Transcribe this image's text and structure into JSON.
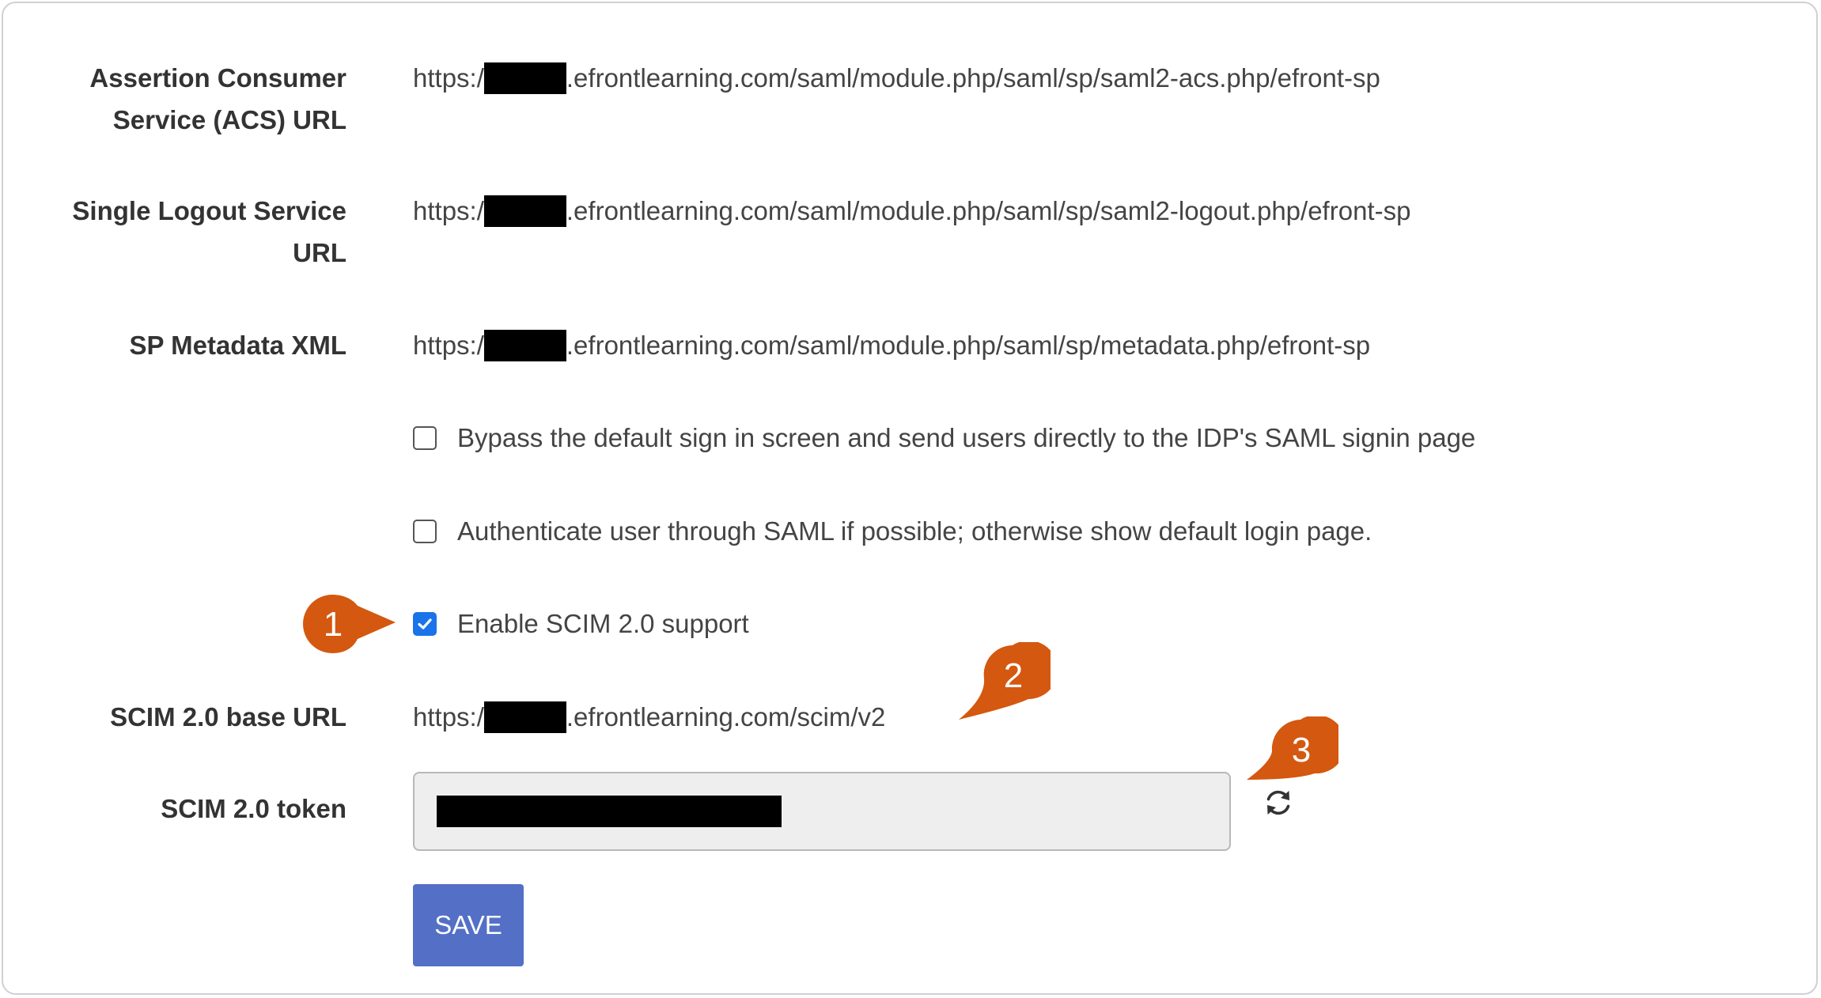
{
  "fields": {
    "acs": {
      "label_line1": "Assertion Consumer",
      "label_line2": "Service (ACS) URL",
      "prefix": "https:/",
      "suffix": ".efrontlearning.com/saml/module.php/saml/sp/saml2-acs.php/efront-sp"
    },
    "slo": {
      "label_line1": "Single Logout Service",
      "label_line2": "URL",
      "prefix": "https:/",
      "suffix": ".efrontlearning.com/saml/module.php/saml/sp/saml2-logout.php/efront-sp"
    },
    "metadata": {
      "label": "SP Metadata XML",
      "prefix": "https:/",
      "suffix": ".efrontlearning.com/saml/module.php/saml/sp/metadata.php/efront-sp"
    }
  },
  "options": {
    "bypass": {
      "label": "Bypass the default sign in screen and send users directly to the IDP's SAML signin page",
      "checked": false
    },
    "fallback": {
      "label": "Authenticate user through SAML if possible; otherwise show default login page.",
      "checked": false
    },
    "scim": {
      "label": "Enable SCIM 2.0 support",
      "checked": true
    }
  },
  "scim": {
    "base_url_label": "SCIM 2.0 base URL",
    "base_url_prefix": "https:/",
    "base_url_suffix": ".efrontlearning.com/scim/v2",
    "token_label": "SCIM 2.0 token",
    "refresh_icon": "refresh-icon"
  },
  "save_label": "SAVE",
  "callouts": {
    "one": "1",
    "two": "2",
    "three": "3"
  },
  "colors": {
    "callout": "#d4580f",
    "checkbox_checked": "#1a73e8",
    "save_button": "#5370c6"
  }
}
